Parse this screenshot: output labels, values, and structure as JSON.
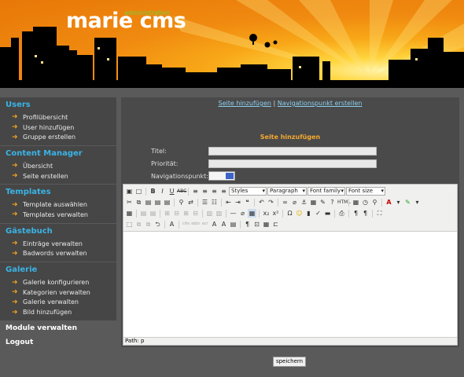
{
  "header": {
    "logo": "marie cms",
    "logo_sub": "administration"
  },
  "sidebar": {
    "sections": [
      {
        "title": "Users",
        "items": [
          "Profilübersicht",
          "User hinzufügen",
          "Gruppe erstellen"
        ]
      },
      {
        "title": "Content Manager",
        "items": [
          "Übersicht",
          "Seite erstellen"
        ]
      },
      {
        "title": "Templates",
        "items": [
          "Template auswählen",
          "Templates verwalten"
        ]
      },
      {
        "title": "Gästebuch",
        "items": [
          "Einträge verwalten",
          "Badwords verwalten"
        ]
      },
      {
        "title": "Galerie",
        "items": [
          "Galerie konfigurieren",
          "Kategorien verwalten",
          "Galerie verwalten",
          "Bild hinzufügen"
        ]
      }
    ],
    "module_label": "Module verwalten",
    "logout_label": "Logout"
  },
  "main": {
    "link_add_page": "Seite hinzufügen",
    "link_sep": "|",
    "link_add_nav": "Navigationspunkt erstellen",
    "form_title": "Seite hinzufügen",
    "label_title": "Titel:",
    "label_priority": "Priorität:",
    "label_nav": "Navigationspunkt:",
    "title_value": "",
    "priority_value": ""
  },
  "editor": {
    "dd_styles": "Styles",
    "dd_paragraph": "Paragraph",
    "dd_font_family": "Font family",
    "dd_font_size": "Font size",
    "status_path": "Path: p"
  },
  "save_label": "speichern",
  "colors": {
    "accent": "#3ab4e6",
    "heading": "#f4a830",
    "link": "#8ccfee"
  }
}
